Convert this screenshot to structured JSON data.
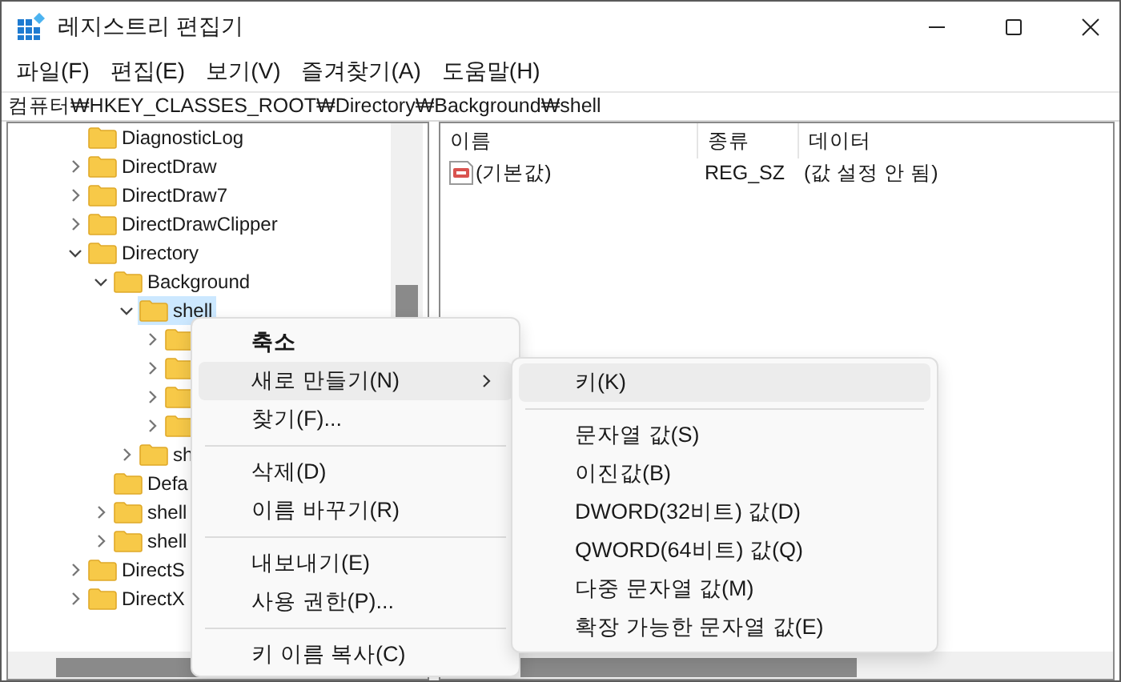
{
  "window": {
    "title": "레지스트리 편집기"
  },
  "menu_bar": [
    "파일(F)",
    "편집(E)",
    "보기(V)",
    "즐겨찾기(A)",
    "도움말(H)"
  ],
  "address": "컴퓨터₩HKEY_CLASSES_ROOT₩Directory₩Background₩shell",
  "tree": [
    {
      "label": "DiagnosticLog"
    },
    {
      "label": "DirectDraw",
      "expanded": false
    },
    {
      "label": "DirectDraw7",
      "expanded": false
    },
    {
      "label": "DirectDrawClipper",
      "expanded": false
    },
    {
      "label": "Directory",
      "expanded": true,
      "children": [
        {
          "label": "Background",
          "expanded": true,
          "children": [
            {
              "label": "shell",
              "expanded": true,
              "selected": true,
              "children": [
                {
                  "expanded": false
                },
                {
                  "expanded": false
                },
                {
                  "expanded": false
                },
                {
                  "expanded": false
                }
              ]
            },
            {
              "label": "sh",
              "expanded": false
            }
          ]
        },
        {
          "label": "Defa"
        },
        {
          "label": "shell",
          "expanded": false
        },
        {
          "label": "shell",
          "expanded": false
        }
      ]
    },
    {
      "label": "DirectS",
      "expanded": false
    },
    {
      "label": "DirectX",
      "expanded": false
    }
  ],
  "list": {
    "columns": [
      "이름",
      "종류",
      "데이터"
    ],
    "rows": [
      {
        "name": "(기본값)",
        "type": "REG_SZ",
        "data": "(값 설정 안 됨)"
      }
    ]
  },
  "context_menu": [
    {
      "kind": "item",
      "label": "축소",
      "default": true,
      "selected": false
    },
    {
      "kind": "item",
      "label": "새로 만들기(N)",
      "submenu": true,
      "selected": true
    },
    {
      "kind": "item",
      "label": "찾기(F)...",
      "selected": false
    },
    {
      "kind": "separator"
    },
    {
      "kind": "item",
      "label": "삭제(D)",
      "selected": false
    },
    {
      "kind": "item",
      "label": "이름 바꾸기(R)",
      "selected": false
    },
    {
      "kind": "separator"
    },
    {
      "kind": "item",
      "label": "내보내기(E)",
      "selected": false
    },
    {
      "kind": "item",
      "label": "사용 권한(P)...",
      "selected": false
    },
    {
      "kind": "separator"
    },
    {
      "kind": "item",
      "label": "키 이름 복사(C)",
      "selected": false
    }
  ],
  "submenu": [
    {
      "kind": "item",
      "label": "키(K)",
      "selected": true
    },
    {
      "kind": "separator"
    },
    {
      "kind": "item",
      "label": "문자열 값(S)",
      "selected": false
    },
    {
      "kind": "item",
      "label": "이진값(B)",
      "selected": false
    },
    {
      "kind": "item",
      "label": "DWORD(32비트) 값(D)",
      "selected": false
    },
    {
      "kind": "item",
      "label": "QWORD(64비트) 값(Q)",
      "selected": false
    },
    {
      "kind": "item",
      "label": "다중 문자열 값(M)",
      "selected": false
    },
    {
      "kind": "item",
      "label": "확장 가능한 문자열 값(E)",
      "selected": false
    }
  ]
}
